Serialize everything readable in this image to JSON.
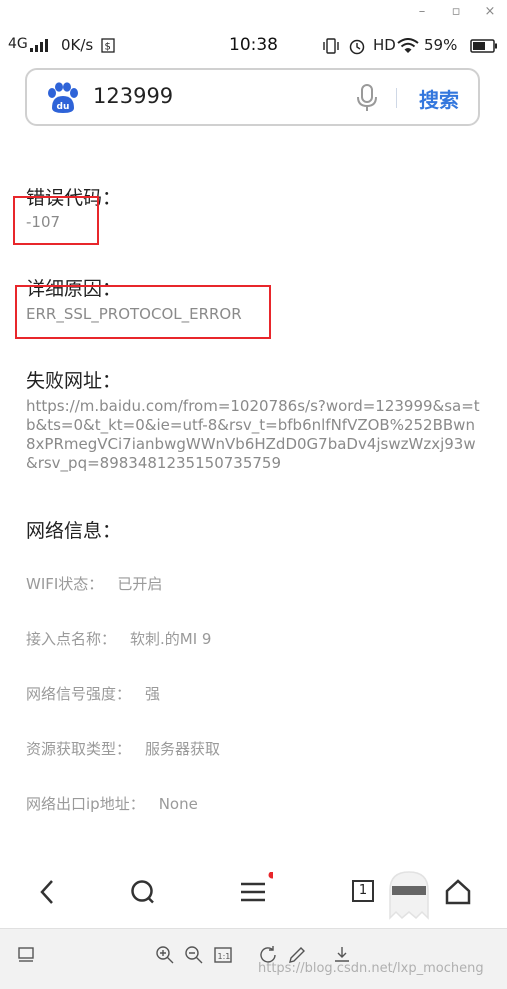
{
  "window": {
    "minimize": "–",
    "maximize": "▫",
    "close": "×"
  },
  "statusbar": {
    "network": "4G",
    "speed": "0K/s",
    "time": "10:38",
    "hd": "HD",
    "battery": "59%"
  },
  "search": {
    "query": "123999",
    "button": "搜索"
  },
  "error": {
    "code_label": "错误代码：",
    "code_value": "-107",
    "reason_label": "详细原因：",
    "reason_value": "ERR_SSL_PROTOCOL_ERROR",
    "url_label": "失败网址：",
    "url_value": "https://m.baidu.com/from=1020786s/s?word=123999&sa=tb&ts=0&t_kt=0&ie=utf-8&rsv_t=bfb6nlfNfVZOB%252BBwn8xPRmegVCi7ianbwgWWnVb6HZdD0G7baDv4jswzWzxj93w&rsv_pq=8983481235150735759"
  },
  "network_info": {
    "title": "网络信息：",
    "rows": [
      {
        "label": "WIFI状态：",
        "value": "已开启"
      },
      {
        "label": "接入点名称：",
        "value": "软刺.的MI 9"
      },
      {
        "label": "网络信号强度：",
        "value": "强"
      },
      {
        "label": "资源获取类型：",
        "value": "服务器获取"
      },
      {
        "label": "网络出口ip地址：",
        "value": "None"
      }
    ]
  },
  "nav": {
    "tabs_count": "1"
  },
  "watermark": "https://blog.csdn.net/lxp_mocheng",
  "colors": {
    "accent": "#3377dd",
    "highlight": "#e8262b",
    "muted": "#8a8a8a"
  }
}
